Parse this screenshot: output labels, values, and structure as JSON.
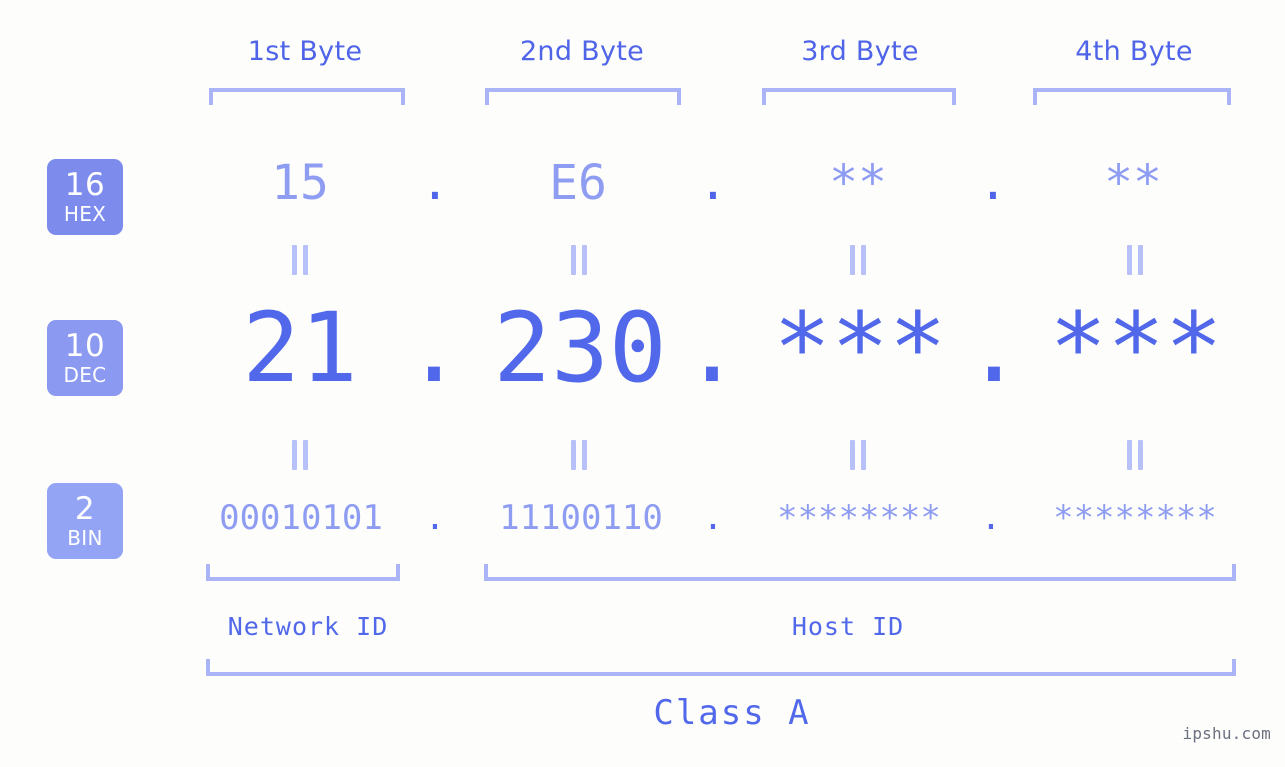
{
  "meta": {
    "background_color": "#fdfefb",
    "accent_strong": "#5268ea",
    "accent_mid": "#8e9cf2",
    "accent_light": "#aab4f7",
    "badge_hex_color": "#7c8bec",
    "badge_dec_color": "#8b99f0",
    "badge_bin_color": "#93a4f5"
  },
  "columns": [
    {
      "header": "1st Byte"
    },
    {
      "header": "2nd Byte"
    },
    {
      "header": "3rd Byte"
    },
    {
      "header": "4th Byte"
    }
  ],
  "rows": [
    {
      "badge_number": "16",
      "badge_name": "HEX",
      "values": [
        "15",
        "E6",
        "**",
        "**"
      ],
      "separator": "."
    },
    {
      "badge_number": "10",
      "badge_name": "DEC",
      "values": [
        "21",
        "230",
        "***",
        "***"
      ],
      "separator": "."
    },
    {
      "badge_number": "2",
      "badge_name": "BIN",
      "values": [
        "00010101",
        "11100110",
        "********",
        "********"
      ],
      "separator": "."
    }
  ],
  "segments": {
    "network_id": "Network ID",
    "host_id": "Host ID",
    "class": "Class A"
  },
  "watermark": "ipshu.com"
}
